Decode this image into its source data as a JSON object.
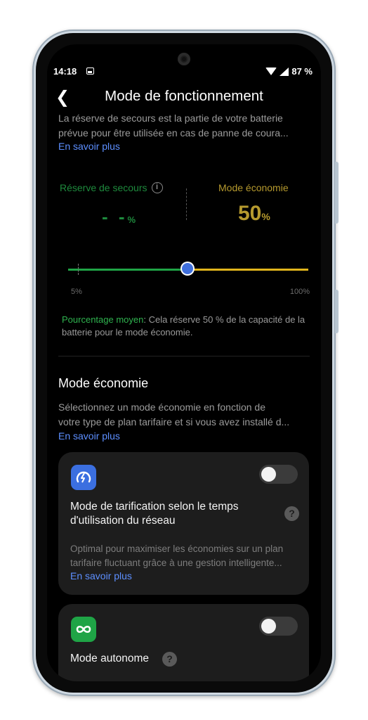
{
  "status_bar": {
    "time": "14:18",
    "battery": "87 %"
  },
  "header": {
    "title": "Mode de fonctionnement"
  },
  "intro": {
    "line1": "La réserve de secours est la partie de votre batterie",
    "line2": "prévue pour être utilisée en cas de panne de coura...",
    "link": "En savoir plus"
  },
  "reserve": {
    "label": "Réserve de secours",
    "value": "- -",
    "unit": "%",
    "economy_label": "Mode économie",
    "economy_value": "50",
    "economy_unit": "%",
    "slider_min": "5%",
    "slider_max": "100%",
    "slider_level": 0.5,
    "avg_label": "Pourcentage moyen",
    "avg_text": ": Cela réserve 50 % de la capacité de la batterie pour le mode économie."
  },
  "economy": {
    "title": "Mode économie",
    "line1": "Sélectionnez un mode économie en fonction de",
    "line2": "votre type de plan tarifaire et si vous avez installé d...",
    "link": "En savoir plus"
  },
  "cards": {
    "tou": {
      "title_line1": "Mode de tarification selon le temps",
      "title_line2": "d'utilisation du réseau",
      "help": "?",
      "desc_line1": "Optimal pour maximiser les économies sur un plan",
      "desc_line2": "tarifaire fluctuant grâce à une gestion intelligente...",
      "link": "En savoir plus",
      "enabled": false,
      "icon": "gauge-icon",
      "icon_color": "#3b6fe0"
    },
    "autonomous": {
      "title": "Mode autonome",
      "help": "?",
      "enabled": false,
      "icon": "infinity-icon",
      "icon_color": "#1fa446"
    }
  },
  "colors": {
    "green": "#1fa446",
    "yellow": "#e0b51c",
    "accent": "#5d8fff",
    "thumb": "#3f6fdc"
  }
}
